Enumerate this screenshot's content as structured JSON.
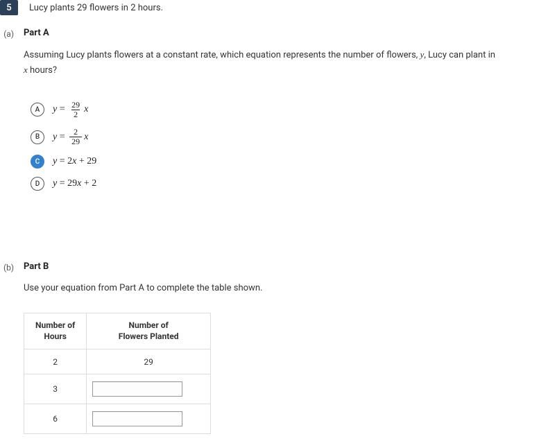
{
  "question": {
    "number": "5",
    "text_before": "Lucy plants ",
    "val1": "29",
    "text_mid": " flowers in ",
    "val2": "2",
    "text_after": " hours."
  },
  "partA": {
    "sub_label": "(a)",
    "title": "Part A",
    "desc_1": "Assuming Lucy plants flowers at a constant rate, which equation represents the number of flowers, ",
    "var_y": "y",
    "desc_2": ", Lucy can plant in ",
    "var_x": "x",
    "desc_3": " hours?",
    "options": {
      "A": {
        "letter": "A",
        "frac_num": "29",
        "frac_den": "2"
      },
      "B": {
        "letter": "B",
        "frac_num": "2",
        "frac_den": "29"
      },
      "C": {
        "letter": "C",
        "coef": "2",
        "const": "29"
      },
      "D": {
        "letter": "D",
        "coef": "29",
        "const": "2"
      }
    }
  },
  "partB": {
    "sub_label": "(b)",
    "title": "Part B",
    "desc": "Use your equation from Part A to complete the table shown.",
    "table": {
      "header1_l1": "Number of",
      "header1_l2": "Hours",
      "header2_l1": "Number of",
      "header2_l2": "Flowers Planted",
      "rows": [
        {
          "hours": "2",
          "flowers": "29"
        },
        {
          "hours": "3",
          "flowers": ""
        },
        {
          "hours": "6",
          "flowers": ""
        }
      ]
    }
  }
}
